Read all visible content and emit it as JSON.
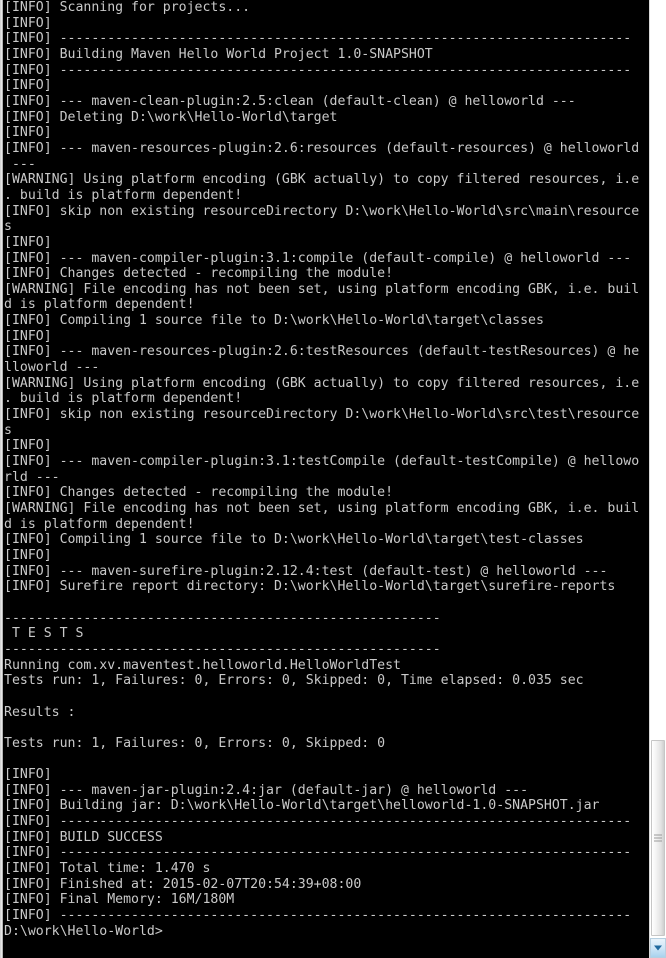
{
  "window": {
    "type": "windows-command-prompt",
    "background_color": "#000000",
    "text_color": "#c9c9c9"
  },
  "terminal": {
    "prompt": "D:\\work\\Hello-World>",
    "lines": [
      "[INFO] Scanning for projects...",
      "[INFO] ",
      "[INFO] ------------------------------------------------------------------------",
      "[INFO] Building Maven Hello World Project 1.0-SNAPSHOT",
      "[INFO] ------------------------------------------------------------------------",
      "[INFO] ",
      "[INFO] --- maven-clean-plugin:2.5:clean (default-clean) @ helloworld ---",
      "[INFO] Deleting D:\\work\\Hello-World\\target",
      "[INFO] ",
      "[INFO] --- maven-resources-plugin:2.6:resources (default-resources) @ helloworld",
      " ---",
      "[WARNING] Using platform encoding (GBK actually) to copy filtered resources, i.e",
      ". build is platform dependent!",
      "[INFO] skip non existing resourceDirectory D:\\work\\Hello-World\\src\\main\\resource",
      "s",
      "[INFO] ",
      "[INFO] --- maven-compiler-plugin:3.1:compile (default-compile) @ helloworld ---",
      "[INFO] Changes detected - recompiling the module!",
      "[WARNING] File encoding has not been set, using platform encoding GBK, i.e. buil",
      "d is platform dependent!",
      "[INFO] Compiling 1 source file to D:\\work\\Hello-World\\target\\classes",
      "[INFO] ",
      "[INFO] --- maven-resources-plugin:2.6:testResources (default-testResources) @ he",
      "lloworld ---",
      "[WARNING] Using platform encoding (GBK actually) to copy filtered resources, i.e",
      ". build is platform dependent!",
      "[INFO] skip non existing resourceDirectory D:\\work\\Hello-World\\src\\test\\resource",
      "s",
      "[INFO] ",
      "[INFO] --- maven-compiler-plugin:3.1:testCompile (default-testCompile) @ hellowo",
      "rld ---",
      "[INFO] Changes detected - recompiling the module!",
      "[WARNING] File encoding has not been set, using platform encoding GBK, i.e. buil",
      "d is platform dependent!",
      "[INFO] Compiling 1 source file to D:\\work\\Hello-World\\target\\test-classes",
      "[INFO] ",
      "[INFO] --- maven-surefire-plugin:2.12.4:test (default-test) @ helloworld ---",
      "[INFO] Surefire report directory: D:\\work\\Hello-World\\target\\surefire-reports",
      "",
      "-------------------------------------------------------",
      " T E S T S",
      "-------------------------------------------------------",
      "Running com.xv.maventest.helloworld.HelloWorldTest",
      "Tests run: 1, Failures: 0, Errors: 0, Skipped: 0, Time elapsed: 0.035 sec",
      "",
      "Results :",
      "",
      "Tests run: 1, Failures: 0, Errors: 0, Skipped: 0",
      "",
      "[INFO] ",
      "[INFO] --- maven-jar-plugin:2.4:jar (default-jar) @ helloworld ---",
      "[INFO] Building jar: D:\\work\\Hello-World\\target\\helloworld-1.0-SNAPSHOT.jar",
      "[INFO] ------------------------------------------------------------------------",
      "[INFO] BUILD SUCCESS",
      "[INFO] ------------------------------------------------------------------------",
      "[INFO] Total time: 1.470 s",
      "[INFO] Finished at: 2015-02-07T20:54:39+08:00",
      "[INFO] Final Memory: 16M/180M",
      "[INFO] ------------------------------------------------------------------------",
      "D:\\work\\Hello-World>"
    ],
    "build_result": "BUILD SUCCESS",
    "total_time": "1.470 s",
    "finished_at": "2015-02-07T20:54:39+08:00",
    "final_memory": "16M/180M",
    "tests_run": 1,
    "failures": 0,
    "errors": 0,
    "skipped": 0,
    "time_elapsed": "0.035 sec",
    "artifact": "helloworld-1.0-SNAPSHOT.jar",
    "project": "Maven Hello World Project 1.0-SNAPSHOT",
    "module": "helloworld"
  },
  "scrollbar": {
    "down_arrow_icon": "chevron-down-icon",
    "thumb_grip_icon": "grip-lines-icon"
  }
}
